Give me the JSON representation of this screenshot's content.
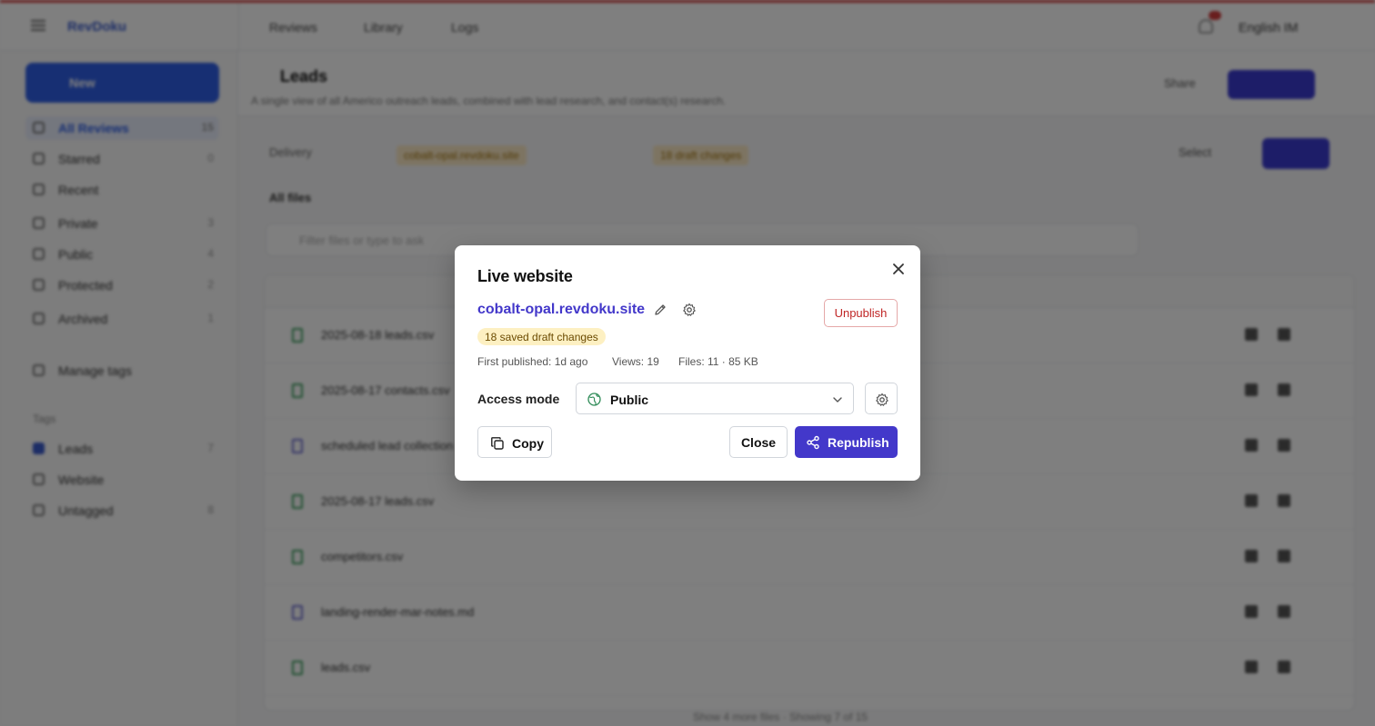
{
  "app": {
    "logo": "RevDoku",
    "nav": [
      "Reviews",
      "Library",
      "Logs"
    ],
    "user": "English IM"
  },
  "sidebar": {
    "new_label": "New",
    "items": [
      {
        "label": "All Reviews",
        "count": "15"
      },
      {
        "label": "Starred",
        "count": "0"
      },
      {
        "label": "Recent",
        "count": ""
      },
      {
        "label": "Private",
        "count": "3"
      },
      {
        "label": "Public",
        "count": "4"
      },
      {
        "label": "Protected",
        "count": "2"
      },
      {
        "label": "Archived",
        "count": "1"
      }
    ],
    "manage_tags": "Manage tags",
    "tags_label": "Tags",
    "tags": [
      {
        "label": "Leads",
        "count": "7"
      },
      {
        "label": "Website",
        "count": ""
      },
      {
        "label": "Untagged",
        "count": "8"
      }
    ]
  },
  "page": {
    "title": "Leads",
    "description": "A single view of all Americo outreach leads, combined with lead research, and contact(s) research.",
    "share_label": "Share",
    "toolbar_label": "Delivery",
    "chip_1": "cobalt-opal.revdoku.site",
    "chip_2": "18 draft changes",
    "select_label": "Select",
    "files_count": "All files",
    "search_placeholder": "Filter files or type to ask",
    "files": [
      "2025-08-18 leads.csv",
      "2025-08-17 contacts.csv",
      "scheduled lead collection",
      "2025-08-17 leads.csv",
      "competitors.csv",
      "landing-render-mar-notes.md",
      "leads.csv"
    ],
    "footer": "Show 4 more files · Showing 7 of 15"
  },
  "modal": {
    "title": "Live website",
    "site_url": "cobalt-opal.revdoku.site",
    "unpublish_label": "Unpublish",
    "draft_badge": "18 saved draft changes",
    "first_published": "First published: 1d ago",
    "views": "Views: 19",
    "files": "Files: 11 · 85 KB",
    "access_label": "Access mode",
    "access_value": "Public",
    "copy_label": "Copy",
    "close_label": "Close",
    "republish_label": "Republish"
  },
  "colors": {
    "accent": "#4338ca",
    "danger": "#c02626",
    "badge_bg": "#fdf0c2"
  }
}
